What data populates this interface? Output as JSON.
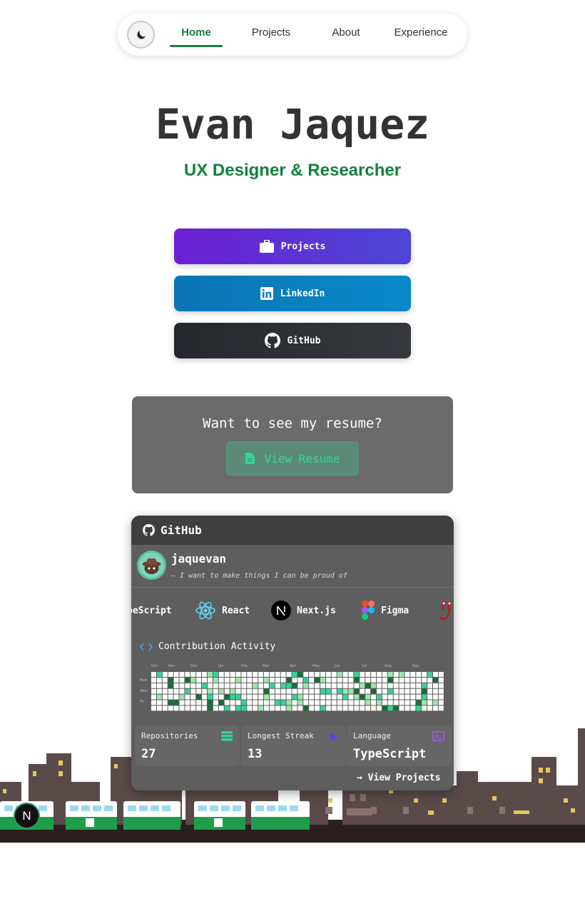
{
  "nav": {
    "items": [
      {
        "label": "Home",
        "active": true
      },
      {
        "label": "Projects",
        "active": false
      },
      {
        "label": "About",
        "active": false
      },
      {
        "label": "Experience",
        "active": false
      }
    ],
    "theme_toggle_icon": "moon-icon"
  },
  "hero": {
    "name": "Evan Jaquez",
    "role": "UX Designer & Researcher"
  },
  "cta": {
    "projects": "Projects",
    "linkedin": "LinkedIn",
    "github": "GitHub"
  },
  "resume": {
    "question": "Want to see my resume?",
    "button": "View Resume"
  },
  "github_card": {
    "title": "GitHub",
    "username": "jaquevan",
    "bio": "— I want to make things I can be proud of",
    "tech": [
      "TypeScript",
      "React",
      "Next.js",
      "Figma"
    ],
    "tech_visible_partial": "peScript",
    "contribution_title": "Contribution Activity",
    "months": [
      "Oct",
      "Nov",
      "Dec",
      "Jan",
      "Feb",
      "Mar",
      "Apr",
      "May",
      "Jun",
      "Jul",
      "Aug",
      "Sep"
    ],
    "day_labels": [
      "Mon",
      "Wed",
      "Fri"
    ],
    "stats": [
      {
        "label": "Repositories",
        "value": "27",
        "icon": "stack-icon"
      },
      {
        "label": "Longest Streak",
        "value": "13",
        "icon": "star-icon"
      },
      {
        "label": "Language",
        "value": "TypeScript",
        "icon": "terminal-icon"
      }
    ],
    "view_projects": "→ View Projects"
  },
  "colors": {
    "accent_green": "#15803d",
    "contrib_green": "#34d399",
    "resume_bg": "#6b6b6b"
  },
  "next_badge": "N"
}
